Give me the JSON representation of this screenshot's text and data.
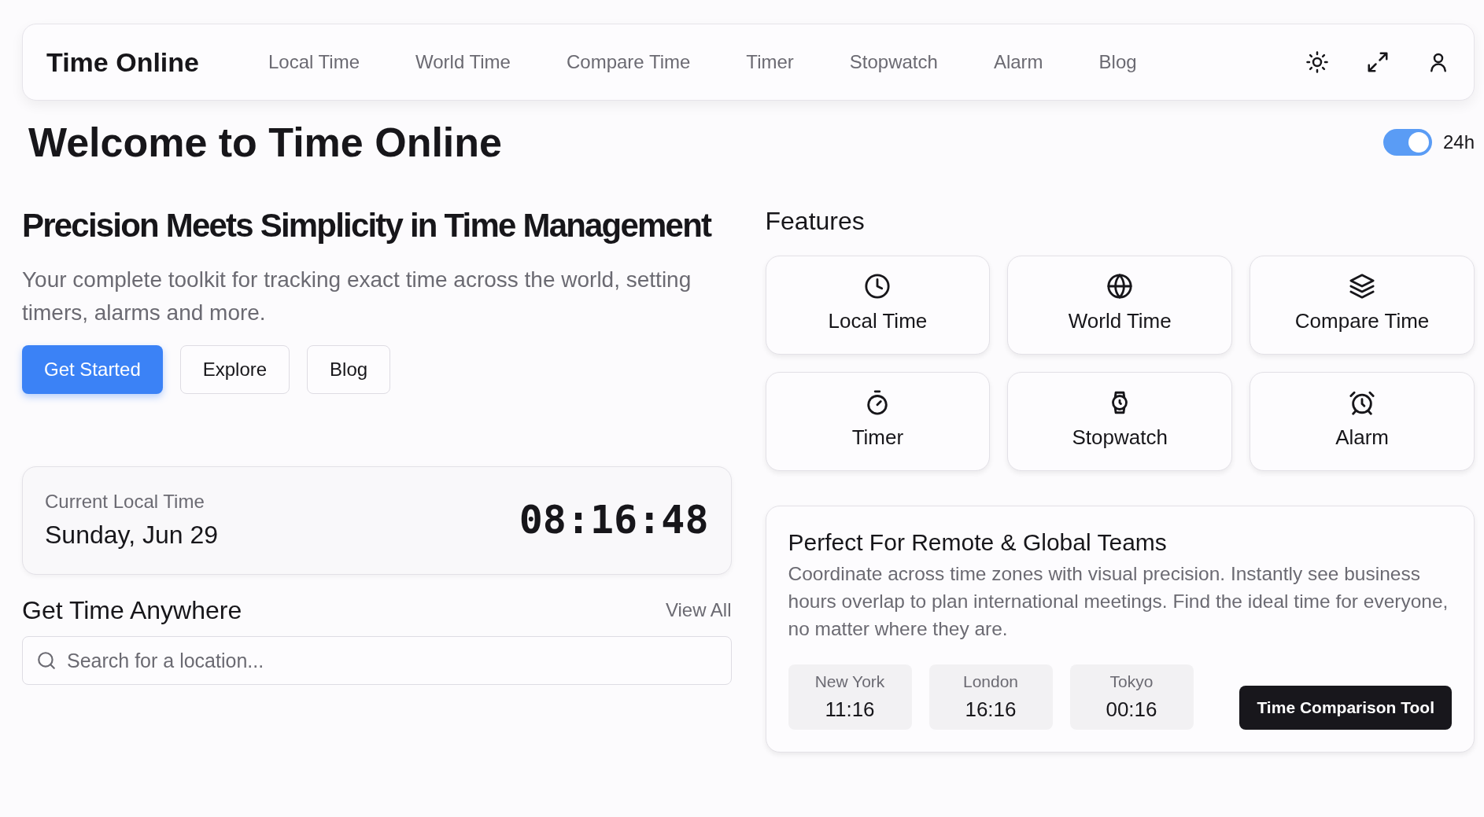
{
  "navbar": {
    "brand": "Time Online",
    "links": [
      "Local Time",
      "World Time",
      "Compare Time",
      "Timer",
      "Stopwatch",
      "Alarm",
      "Blog"
    ]
  },
  "page_title": "Welcome to Time Online",
  "clock_format_toggle": {
    "on": true,
    "label": "24h"
  },
  "hero": {
    "heading": "Precision Meets Simplicity in Time Management",
    "text": "Your complete toolkit for tracking exact time across the world, setting timers, alarms and more.",
    "buttons": [
      {
        "label": "Get Started",
        "kind": "primary"
      },
      {
        "label": "Explore",
        "kind": "outline"
      },
      {
        "label": "Blog",
        "kind": "outline"
      }
    ]
  },
  "local_time": {
    "label": "Current Local Time",
    "date": "Sunday, Jun 29",
    "time": "08:16:48"
  },
  "get_time_anywhere": {
    "heading": "Get Time Anywhere",
    "link": "View All",
    "search": {
      "placeholder": "Search for a location..."
    }
  },
  "features": {
    "heading": "Features",
    "items": [
      "Local Time",
      "World Time",
      "Compare Time",
      "Timer",
      "Stopwatch",
      "Alarm"
    ]
  },
  "remote_teams": {
    "title": "Perfect For Remote & Global Teams",
    "text": "Coordinate across time zones with visual precision. Instantly see business hours overlap to plan international meetings. Find the ideal time for everyone, no matter where they are.",
    "zones": [
      {
        "city": "New York",
        "time": "11:16"
      },
      {
        "city": "London",
        "time": "16:16"
      },
      {
        "city": "Tokyo",
        "time": "00:16"
      }
    ],
    "button": "Time Comparison Tool"
  }
}
